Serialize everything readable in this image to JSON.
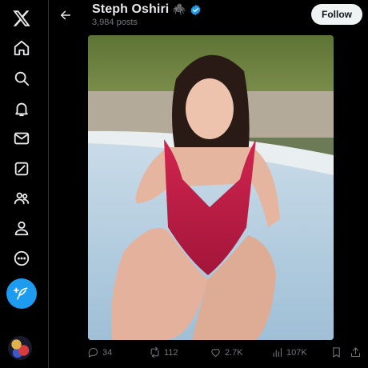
{
  "nav": {
    "items": [
      {
        "name": "x-logo-icon"
      },
      {
        "name": "home-icon"
      },
      {
        "name": "search-icon"
      },
      {
        "name": "notifications-bell-icon"
      },
      {
        "name": "messages-envelope-icon"
      },
      {
        "name": "grok-icon"
      },
      {
        "name": "communities-icon"
      },
      {
        "name": "profile-icon"
      },
      {
        "name": "more-icon"
      }
    ],
    "compose_icon": "feather-plus-icon"
  },
  "header": {
    "name": "Steph Oshiri",
    "emoji": "🕷️",
    "post_count": "3,984 posts",
    "follow_label": "Follow"
  },
  "post": {
    "image_icon": "photo",
    "stats": {
      "replies": "34",
      "reposts": "112",
      "likes": "2.7K",
      "views": "107K"
    }
  },
  "colors": {
    "accent": "#1d9bf0",
    "background": "#000000",
    "muted": "#71767b",
    "follow_bg": "#eff3f4"
  }
}
